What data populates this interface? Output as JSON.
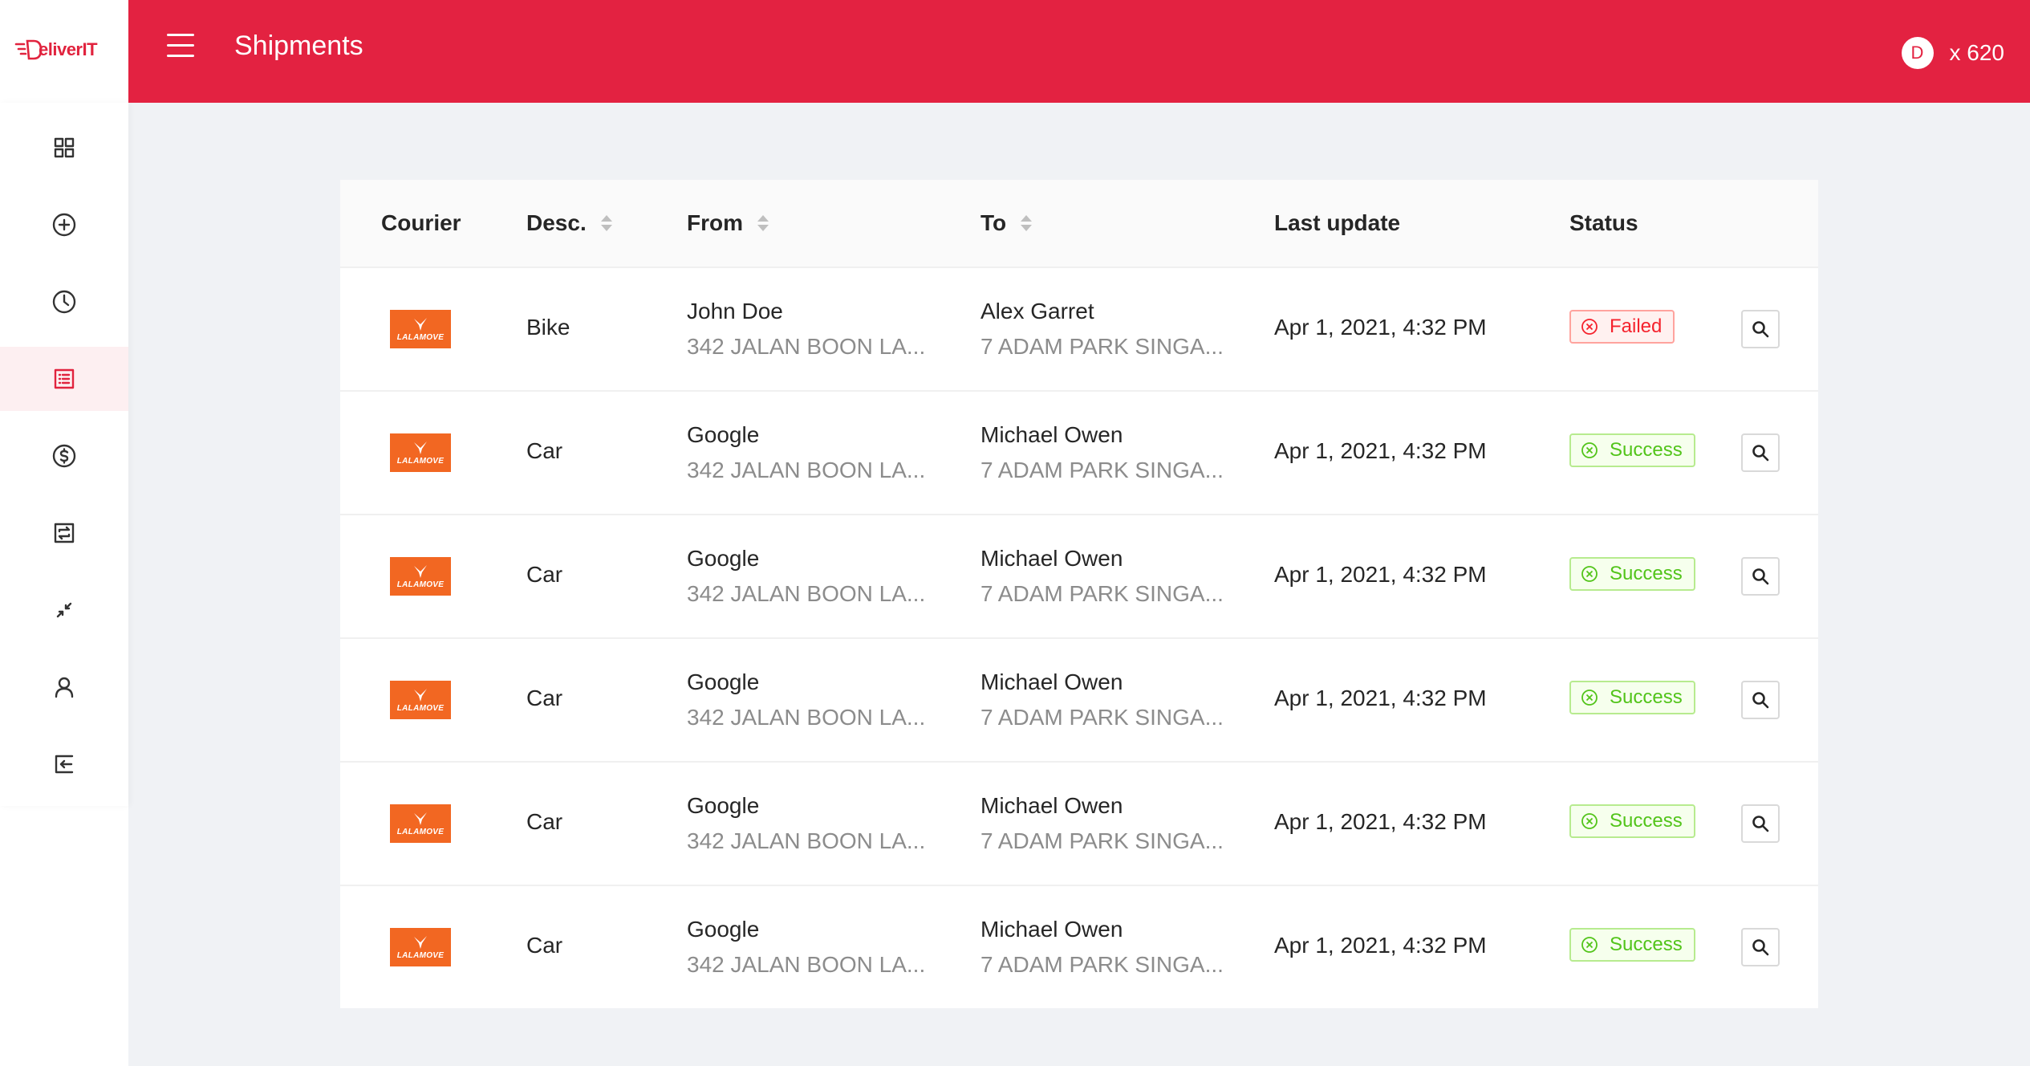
{
  "app": {
    "logo_text": "eliverIT",
    "logo_initial": "D"
  },
  "header": {
    "title": "Shipments",
    "avatar_initial": "D",
    "credits": "x 620"
  },
  "sidebar": {
    "items": [
      {
        "icon": "dashboard-icon",
        "active": false
      },
      {
        "icon": "add-circle-icon",
        "active": false
      },
      {
        "icon": "clock-icon",
        "active": false
      },
      {
        "icon": "list-icon",
        "active": true
      },
      {
        "icon": "dollar-icon",
        "active": false
      },
      {
        "icon": "exchange-icon",
        "active": false
      },
      {
        "icon": "shrink-icon",
        "active": false
      },
      {
        "icon": "user-icon",
        "active": false
      },
      {
        "icon": "logout-icon",
        "active": false
      }
    ]
  },
  "table": {
    "columns": {
      "courier": "Courier",
      "desc": "Desc.",
      "from": "From",
      "to": "To",
      "last_update": "Last update",
      "status": "Status"
    },
    "rows": [
      {
        "courier": "LALAMOVE",
        "desc": "Bike",
        "from_name": "John Doe",
        "from_addr": "342 JALAN BOON LA...",
        "to_name": "Alex Garret",
        "to_addr": "7 ADAM PARK SINGA...",
        "updated": "Apr 1, 2021, 4:32 PM",
        "status": "Failed"
      },
      {
        "courier": "LALAMOVE",
        "desc": "Car",
        "from_name": "Google",
        "from_addr": "342 JALAN BOON LA...",
        "to_name": "Michael Owen",
        "to_addr": "7 ADAM PARK SINGA...",
        "updated": "Apr 1, 2021, 4:32 PM",
        "status": "Success"
      },
      {
        "courier": "LALAMOVE",
        "desc": "Car",
        "from_name": "Google",
        "from_addr": "342 JALAN BOON LA...",
        "to_name": "Michael Owen",
        "to_addr": "7 ADAM PARK SINGA...",
        "updated": "Apr 1, 2021, 4:32 PM",
        "status": "Success"
      },
      {
        "courier": "LALAMOVE",
        "desc": "Car",
        "from_name": "Google",
        "from_addr": "342 JALAN BOON LA...",
        "to_name": "Michael Owen",
        "to_addr": "7 ADAM PARK SINGA...",
        "updated": "Apr 1, 2021, 4:32 PM",
        "status": "Success"
      },
      {
        "courier": "LALAMOVE",
        "desc": "Car",
        "from_name": "Google",
        "from_addr": "342 JALAN BOON LA...",
        "to_name": "Michael Owen",
        "to_addr": "7 ADAM PARK SINGA...",
        "updated": "Apr 1, 2021, 4:32 PM",
        "status": "Success"
      },
      {
        "courier": "LALAMOVE",
        "desc": "Car",
        "from_name": "Google",
        "from_addr": "342 JALAN BOON LA...",
        "to_name": "Michael Owen",
        "to_addr": "7 ADAM PARK SINGA...",
        "updated": "Apr 1, 2021, 4:32 PM",
        "status": "Success"
      }
    ]
  },
  "colors": {
    "brand": "#e32241",
    "failed": "#f5222d",
    "success": "#52c41a",
    "courier_logo": "#f26722"
  }
}
